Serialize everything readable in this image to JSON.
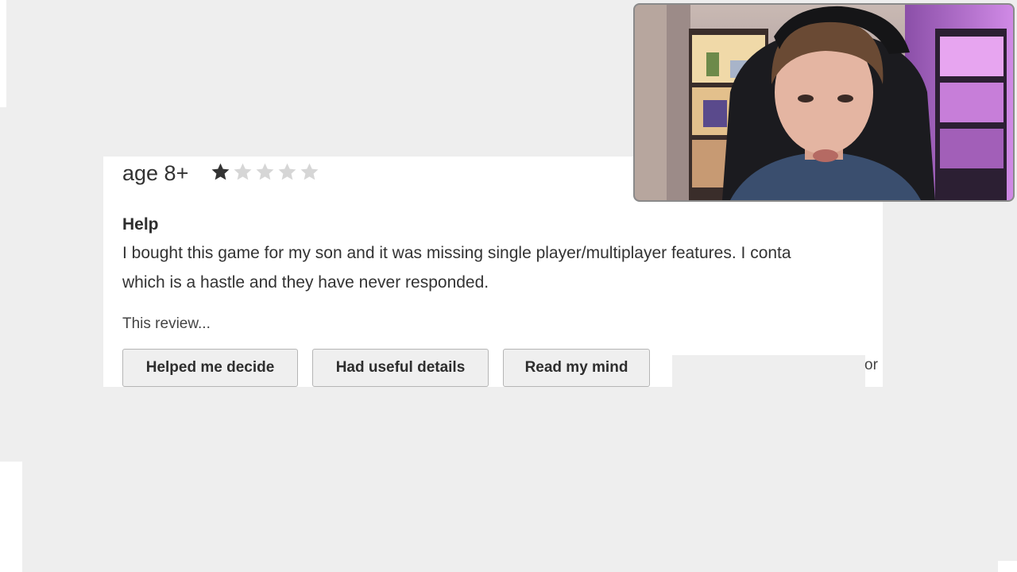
{
  "review": {
    "age": "age 8+",
    "rating": 1,
    "rating_max": 5,
    "title": "Help",
    "body_line1": "I bought this game for my son and it was missing single player/multiplayer features. I conta",
    "body_line2": "which is a hastle and they have never responded.",
    "feedback_prompt": "This review...",
    "buttons": {
      "helped": "Helped me decide",
      "details": "Had useful details",
      "mind": "Read my mind"
    },
    "cut_text": "or"
  },
  "colors": {
    "star_filled": "#333333",
    "star_empty": "#d6d6d6",
    "page_bg": "#eeeeee"
  },
  "icons": {
    "star": "star-icon"
  }
}
